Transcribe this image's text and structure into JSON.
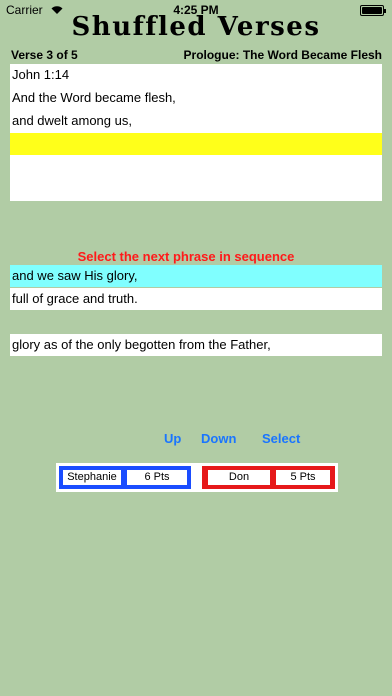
{
  "status_bar": {
    "carrier": "Carrier",
    "wifi_icon": "wifi-icon",
    "time": "4:25 PM",
    "battery_icon": "battery-icon",
    "battery_level": 1.0
  },
  "app": {
    "title": "Shuffled Verses"
  },
  "header": {
    "verse_counter": "Verse 3 of 5",
    "passage_title": "Prologue: The Word Became Flesh"
  },
  "sequence": {
    "lines": [
      "John 1:14",
      "And the Word became flesh,",
      "and dwelt among us,",
      ""
    ]
  },
  "prompt": "Select the next phrase in sequence",
  "choices": [
    "and we saw His glory,",
    "full of grace and truth."
  ],
  "extra_phrase": "glory as of the only begotten from the Father,",
  "controls": {
    "up": "Up",
    "down": "Down",
    "select": "Select"
  },
  "players": [
    {
      "name": "Stephanie",
      "points": "6 Pts",
      "color": "#1a4dff"
    },
    {
      "name": "Don",
      "points": "5 Pts",
      "color": "#e6191a"
    }
  ],
  "colors": {
    "background": "#b1cca5",
    "highlight": "#ffff1a",
    "selected": "#80ffff",
    "prompt": "#ff1a1a",
    "control": "#1a75ff"
  }
}
